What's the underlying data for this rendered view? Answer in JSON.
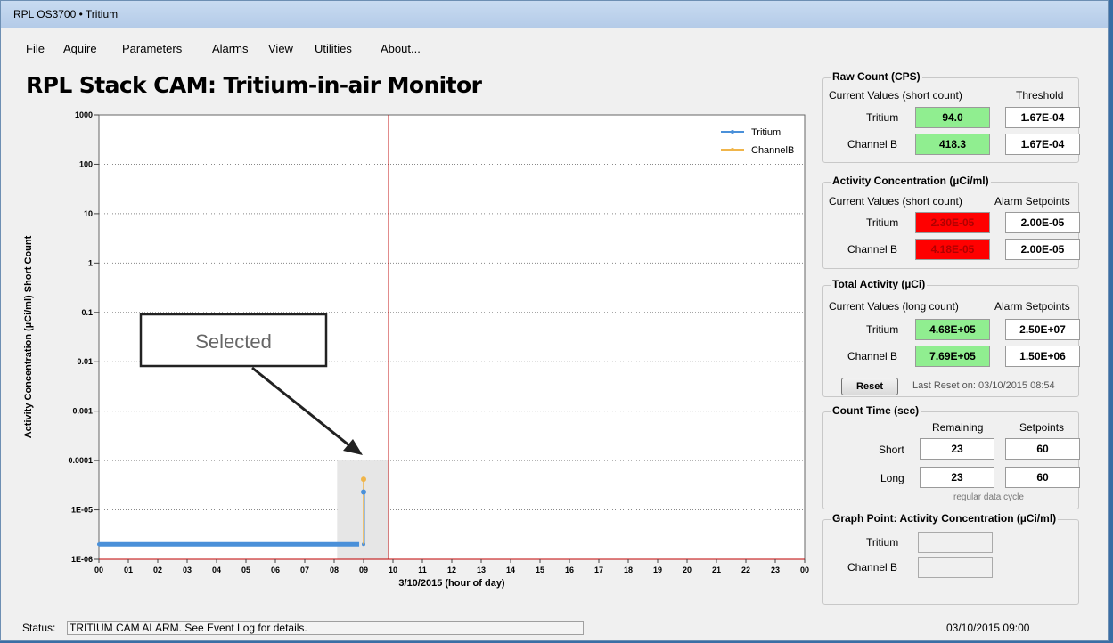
{
  "window": {
    "title": "RPL OS3700 • Tritium"
  },
  "menu": [
    "File",
    "Aquire",
    "Parameters",
    "Alarms",
    "View",
    "Utilities",
    "About..."
  ],
  "app_title": "RPL Stack CAM: Tritium-in-air Monitor",
  "chart_data": {
    "type": "line",
    "ylabel": "Activity Concentration (µCi/ml) Short Count",
    "xlabel": "3/10/2015 (hour of day)",
    "yscale": "log",
    "ylim": [
      1e-06,
      1000
    ],
    "y_ticks": [
      "1000",
      "100",
      "10",
      "1",
      "0.1",
      "0.01",
      "0.001",
      "0.0001",
      "1E-05",
      "1E-06"
    ],
    "x_ticks": [
      "00",
      "01",
      "02",
      "03",
      "04",
      "05",
      "06",
      "07",
      "08",
      "09",
      "10",
      "11",
      "12",
      "13",
      "14",
      "15",
      "16",
      "17",
      "18",
      "19",
      "20",
      "21",
      "22",
      "23",
      "00"
    ],
    "xlim": [
      0,
      24
    ],
    "grid": true,
    "legend_position": "top-right",
    "current_time_marker": 9.85,
    "selection_range": [
      8.1,
      9.85
    ],
    "series": [
      {
        "name": "Tritium",
        "color": "#4a90d9",
        "points": [
          [
            0,
            2e-06
          ],
          [
            1,
            2e-06
          ],
          [
            2,
            2e-06
          ],
          [
            3,
            2e-06
          ],
          [
            4,
            2e-06
          ],
          [
            5,
            2e-06
          ],
          [
            6,
            2e-06
          ],
          [
            7,
            2e-06
          ],
          [
            8,
            2e-06
          ],
          [
            9,
            2e-06
          ],
          [
            9.0,
            2.3e-05
          ]
        ]
      },
      {
        "name": "ChannelB",
        "color": "#f0b54a",
        "points": [
          [
            9.0,
            2e-06
          ],
          [
            9.0,
            4.18e-05
          ]
        ]
      }
    ],
    "annotation": "Selected"
  },
  "panels": {
    "raw_count": {
      "title": "Raw Count (CPS)",
      "col1": "Current Values (short count)",
      "col2": "Threshold",
      "rows": [
        {
          "label": "Tritium",
          "value": "94.0",
          "setpoint": "1.67E-04"
        },
        {
          "label": "Channel B",
          "value": "418.3",
          "setpoint": "1.67E-04"
        }
      ]
    },
    "activity_conc": {
      "title": "Activity Concentration (µCi/ml)",
      "col1": "Current Values (short count)",
      "col2": "Alarm Setpoints",
      "rows": [
        {
          "label": "Tritium",
          "value": "2.30E-05",
          "setpoint": "2.00E-05"
        },
        {
          "label": "Channel B",
          "value": "4.18E-05",
          "setpoint": "2.00E-05"
        }
      ]
    },
    "total_activity": {
      "title": "Total Activity (µCi)",
      "col1": "Current Values (long count)",
      "col2": "Alarm Setpoints",
      "rows": [
        {
          "label": "Tritium",
          "value": "4.68E+05",
          "setpoint": "2.50E+07"
        },
        {
          "label": "Channel B",
          "value": "7.69E+05",
          "setpoint": "1.50E+06"
        }
      ],
      "reset_label": "Reset",
      "last_reset": "Last Reset on: 03/10/2015 08:54"
    },
    "count_time": {
      "title": "Count Time (sec)",
      "col1": "Remaining",
      "col2": "Setpoints",
      "rows": [
        {
          "label": "Short",
          "value": "23",
          "setpoint": "60"
        },
        {
          "label": "Long",
          "value": "23",
          "setpoint": "60"
        }
      ],
      "note": "regular data cycle"
    },
    "graph_point": {
      "title": "Graph Point: Activity Concentration (µCi/ml)",
      "rows": [
        {
          "label": "Tritium",
          "value": ""
        },
        {
          "label": "Channel B",
          "value": ""
        }
      ]
    }
  },
  "status": {
    "label": "Status:",
    "message": "TRITIUM CAM ALARM. See Event Log for details.",
    "datetime": "03/10/2015 09:00"
  },
  "colors": {
    "ok": "#90ee90",
    "alarm": "#ff0000",
    "marker": "#c00000"
  }
}
